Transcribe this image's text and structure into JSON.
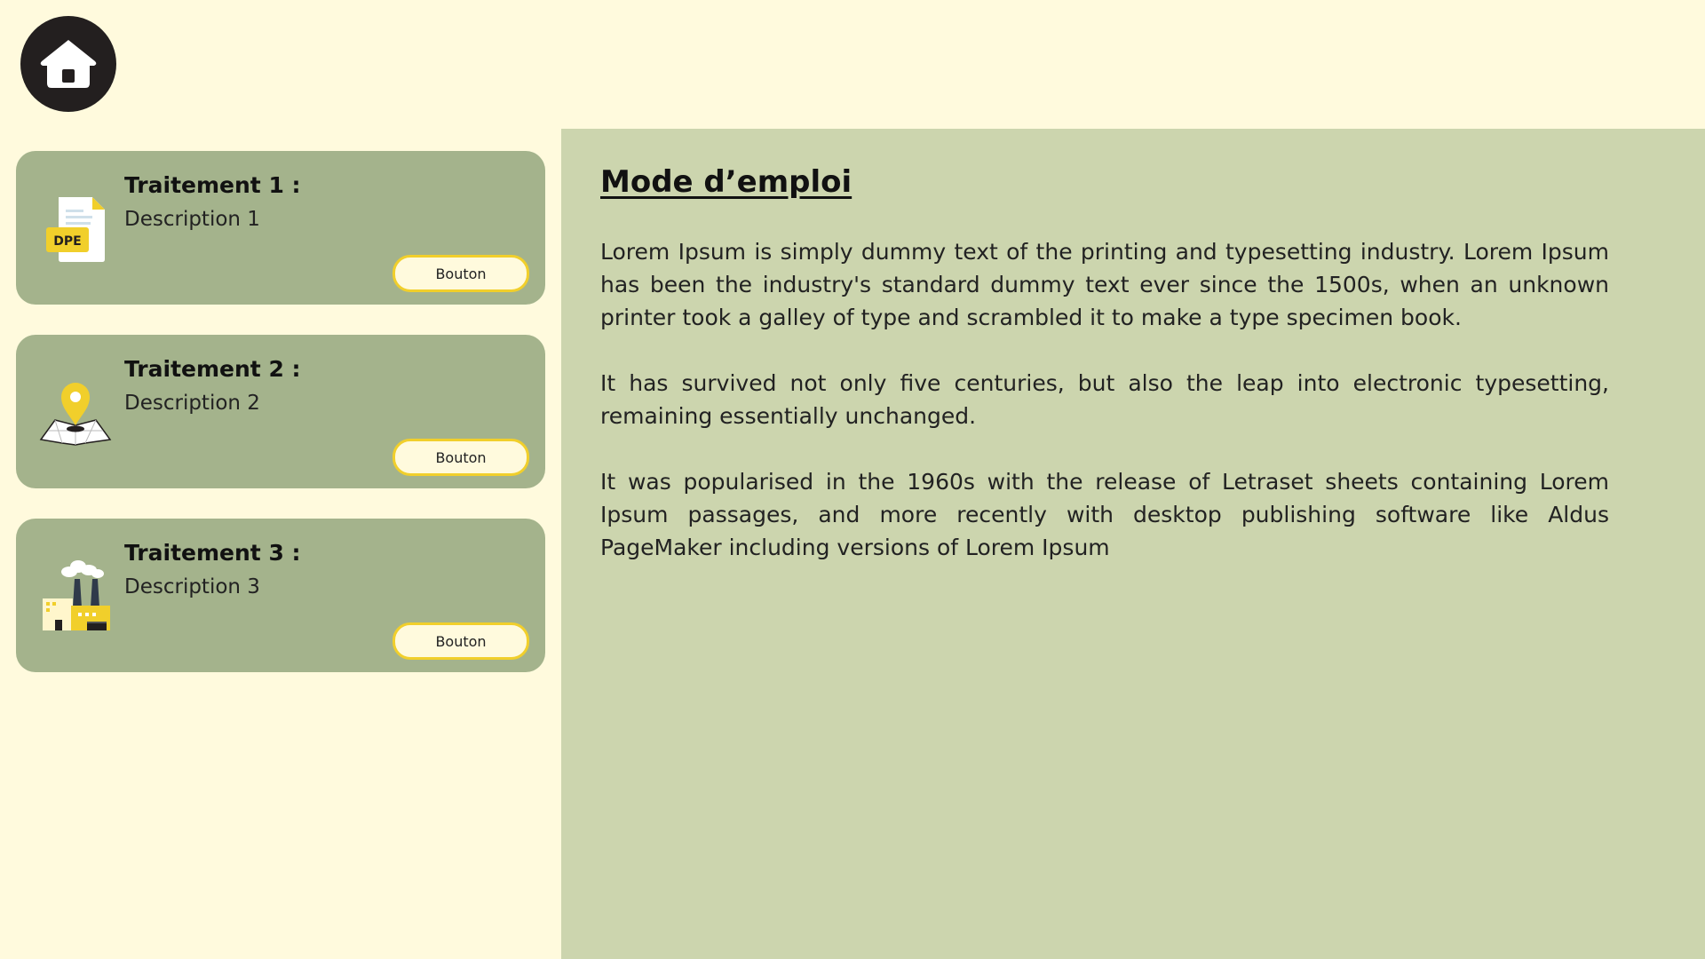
{
  "nav": {
    "home_icon": "home-icon"
  },
  "cards": [
    {
      "title": "Traitement 1 :",
      "description": "Description 1",
      "button_label": "Bouton",
      "icon": "dpe-document-icon",
      "icon_text": "DPE"
    },
    {
      "title": "Traitement 2 :",
      "description": "Description 2",
      "button_label": "Bouton",
      "icon": "map-pin-icon"
    },
    {
      "title": "Traitement 3 :",
      "description": "Description 3",
      "button_label": "Bouton",
      "icon": "factory-icon"
    }
  ],
  "instructions": {
    "title": "Mode d’emploi",
    "paragraphs": [
      "Lorem Ipsum is simply dummy text of the printing and typesetting industry. Lorem Ipsum has been the industry's standard dummy text ever since the 1500s, when an unknown printer took a galley of type and scrambled it to make a type specimen book.",
      "It has survived not only five centuries, but also the leap into electronic typesetting, remaining essentially unchanged.",
      "It was popularised in the 1960s with the release of Letraset sheets containing Lorem Ipsum passages, and more recently with desktop publishing software like Aldus PageMaker including versions of Lorem Ipsum"
    ]
  },
  "colors": {
    "background": "#fffadd",
    "card": "#a4b38c",
    "panel": "#ccd5ae",
    "accent_yellow": "#f1cf2b",
    "home_button": "#231f1f"
  }
}
